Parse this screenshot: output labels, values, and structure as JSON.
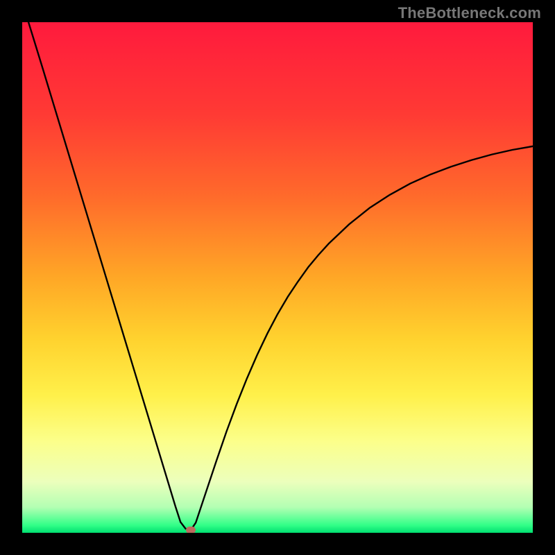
{
  "watermark": "TheBottleneck.com",
  "colors": {
    "background": "#000000",
    "curve": "#000000",
    "gradient_stops": [
      {
        "pos": 0.0,
        "color": "#ff1a3d"
      },
      {
        "pos": 0.18,
        "color": "#ff3a34"
      },
      {
        "pos": 0.34,
        "color": "#ff6a2b"
      },
      {
        "pos": 0.5,
        "color": "#ffa726"
      },
      {
        "pos": 0.62,
        "color": "#ffd22e"
      },
      {
        "pos": 0.73,
        "color": "#fff04a"
      },
      {
        "pos": 0.82,
        "color": "#fcff8a"
      },
      {
        "pos": 0.9,
        "color": "#ecffbc"
      },
      {
        "pos": 0.95,
        "color": "#b3ffb3"
      },
      {
        "pos": 0.985,
        "color": "#33ff88"
      },
      {
        "pos": 1.0,
        "color": "#00e070"
      }
    ],
    "marker": "#bb6b5e"
  },
  "chart_data": {
    "type": "line",
    "title": "",
    "xlabel": "",
    "ylabel": "",
    "xlim": [
      0,
      100
    ],
    "ylim": [
      0,
      100
    ],
    "grid": false,
    "legend": false,
    "annotations": [],
    "x": [
      0,
      2,
      4,
      6,
      8,
      10,
      12,
      14,
      16,
      18,
      20,
      22,
      24,
      26,
      28,
      30,
      31,
      32,
      33,
      34,
      36,
      38,
      40,
      42,
      44,
      46,
      48,
      50,
      52,
      54,
      56,
      58,
      60,
      64,
      68,
      72,
      76,
      80,
      84,
      88,
      92,
      96,
      100
    ],
    "values": [
      104,
      97.5,
      91,
      84.4,
      77.8,
      71.2,
      64.6,
      58,
      51.4,
      44.8,
      38.2,
      31.6,
      25,
      18.4,
      11.8,
      5.2,
      2.1,
      0.8,
      0.5,
      2,
      8,
      14,
      19.8,
      25.2,
      30.2,
      34.8,
      39,
      42.8,
      46.2,
      49.2,
      52,
      54.4,
      56.6,
      60.4,
      63.6,
      66.2,
      68.4,
      70.2,
      71.7,
      73,
      74.1,
      75,
      75.7
    ],
    "optimum": {
      "x": 33,
      "y": 0.5
    }
  }
}
